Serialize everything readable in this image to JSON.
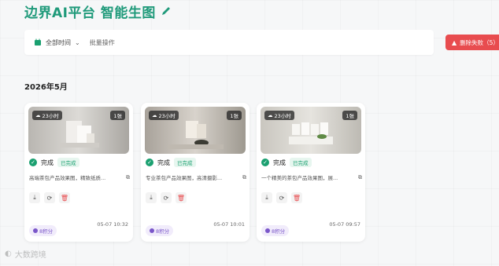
{
  "header": {
    "title": "边界AI平台 智能生图",
    "edit_icon": "edit-pencil-icon",
    "color": "#1f9a7a"
  },
  "toolbar": {
    "time_filter": "全部时间",
    "batch_label": "批量操作",
    "delete_failed_label": "删除失败（5）"
  },
  "section": {
    "title": "2026年5月"
  },
  "cards": [
    {
      "time_badge": "23小时",
      "count_badge": "1张",
      "status": "完成",
      "status_badge": "已完成",
      "description": "高端茶包产品效果图，精致纸质...",
      "points": "8积分",
      "time": "05-07 10:32"
    },
    {
      "time_badge": "23小时",
      "count_badge": "1张",
      "status": "完成",
      "status_badge": "已完成",
      "description": "专业茶包产品效果图，高清摄影...",
      "points": "8积分",
      "time": "05-07 10:01"
    },
    {
      "time_badge": "23小时",
      "count_badge": "1张",
      "status": "完成",
      "status_badge": "已完成",
      "description": "一个精美的茶包产品效果图，展...",
      "points": "8积分",
      "time": "05-07 09:57"
    }
  ],
  "watermark": "大数跨境"
}
